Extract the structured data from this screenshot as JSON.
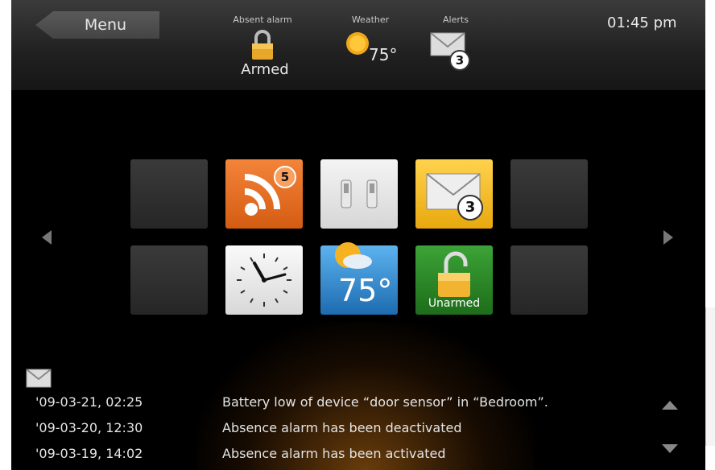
{
  "header": {
    "menu_label": "Menu",
    "absent_alarm_label": "Absent alarm",
    "armed_status": "Armed",
    "weather_label": "Weather",
    "weather_temp": "75°",
    "alerts_label": "Alerts",
    "alerts_count": "3",
    "clock": "01:45 pm"
  },
  "tiles": {
    "rss_badge": "5",
    "mail_badge": "3",
    "weather_temp": "75°",
    "alarm_status": "Unarmed"
  },
  "log": [
    {
      "date": "'09-03-21, 02:25",
      "message": "Battery low of device “door sensor” in “Bedroom”."
    },
    {
      "date": "'09-03-20, 12:30",
      "message": "Absence alarm has been deactivated"
    },
    {
      "date": "'09-03-19, 14:02",
      "message": "Absence alarm has been activated"
    }
  ],
  "colors": {
    "rss_orange": "#e8701e",
    "mail_yellow": "#f2c130",
    "weather_blue": "#2a86c8",
    "alarm_green": "#2d8a2a"
  }
}
